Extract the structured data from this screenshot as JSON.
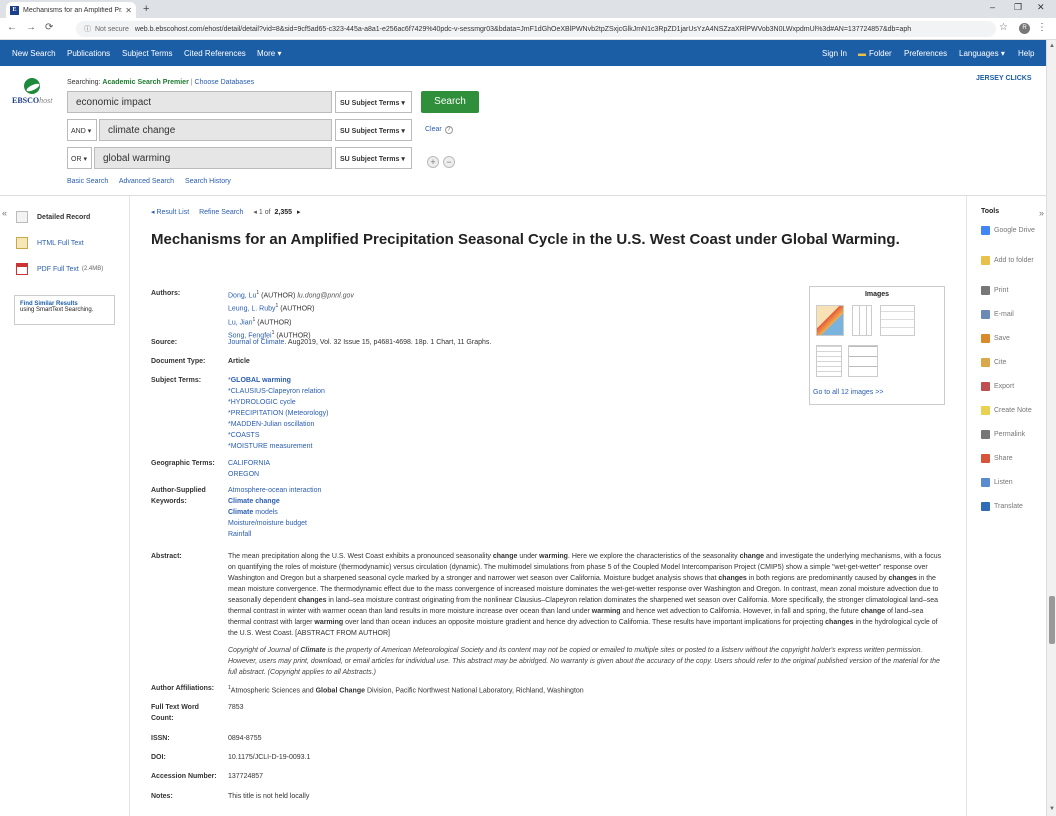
{
  "browser": {
    "tab_title": "Mechanisms for an Amplified Pr...",
    "url": "web.b.ebscohost.com/ehost/detail/detail?vid=8&sid=9cf5ad65-c323-445a-a8a1-e256ac6f7429%40pdc-v-sessmgr03&bdata=JmF1dGhOeXBlPWNvb2tpZSxjcGlkJmN1c3RpZD1jarUsYzA4NSZzaXRlPWVob3N0LWxpdmUl%3d#AN=137724857&db=aph",
    "not_secure": "Not secure",
    "avatar": "R"
  },
  "topnav": {
    "left": [
      "New Search",
      "Publications",
      "Subject Terms",
      "Cited References",
      "More ▾"
    ],
    "right": [
      "Sign In",
      "Folder",
      "Preferences",
      "Languages ▾",
      "Help"
    ]
  },
  "header": {
    "logo_word": "EBSCO",
    "logo_suffix": "host",
    "searching_label": "Searching:",
    "database": "Academic Search Premier",
    "choose": "Choose Databases",
    "jersey": "JERSEY CLICKS",
    "rows": [
      {
        "bool": "",
        "term": "economic impact",
        "field": "SU Subject Terms ▾"
      },
      {
        "bool": "AND ▾",
        "term": "climate change",
        "field": "SU Subject Terms ▾"
      },
      {
        "bool": "OR ▾",
        "term": "global warming",
        "field": "SU Subject Terms ▾"
      }
    ],
    "search_btn": "Search",
    "clear": "Clear",
    "plus": "+",
    "minus": "−",
    "links": [
      "Basic Search",
      "Advanced Search",
      "Search History"
    ]
  },
  "left": {
    "collapse": "«",
    "items": [
      {
        "label": "Detailed Record",
        "suffix": ""
      },
      {
        "label": "HTML Full Text",
        "suffix": ""
      },
      {
        "label": "PDF Full Text",
        "suffix": "(2.4MB)"
      }
    ],
    "similar_title": "Find Similar Results",
    "similar_sub": "using SmartText Searching."
  },
  "record": {
    "nav": {
      "result_list": "◂ Result List",
      "refine": "Refine Search",
      "counter_prefix": "◂ 1 of",
      "counter_total": "2,355",
      "counter_next": "▸"
    },
    "title": "Mechanisms for an Amplified Precipitation Seasonal Cycle in the U.S. West Coast under Global Warming.",
    "labels": {
      "authors": "Authors:",
      "source": "Source:",
      "doctype": "Document Type:",
      "subjects": "Subject Terms:",
      "geo": "Geographic Terms:",
      "keywords": "Author-Supplied Keywords:",
      "abstract": "Abstract:",
      "affil": "Author Affiliations:",
      "wordcount": "Full Text Word Count:",
      "issn": "ISSN:",
      "doi": "DOI:",
      "accession": "Accession Number:",
      "notes": "Notes:"
    },
    "authors": [
      {
        "name": "Dong, Lu",
        "sup": "1",
        "role": "(AUTHOR)",
        "email": "lu.dong@pnnl.gov"
      },
      {
        "name": "Leung, L. Ruby",
        "sup": "1",
        "role": "(AUTHOR)",
        "email": ""
      },
      {
        "name": "Lu, Jian",
        "sup": "1",
        "role": "(AUTHOR)",
        "email": ""
      },
      {
        "name": "Song, Fengfei",
        "sup": "1",
        "role": "(AUTHOR)",
        "email": ""
      }
    ],
    "source_journal": "Journal of Climate",
    "source_rest": ". Aug2019, Vol. 32 Issue 15, p4681-4698. 18p. 1 Chart, 11 Graphs.",
    "doctype": "Article",
    "subjects": [
      "*GLOBAL warming",
      "*CLAUSIUS-Clapeyron relation",
      "*HYDROLOGIC cycle",
      "*PRECIPITATION (Meteorology)",
      "*MADDEN-Julian oscillation",
      "*COASTS",
      "*MOISTURE measurement"
    ],
    "geo": [
      "CALIFORNIA",
      "OREGON"
    ],
    "keywords": [
      "Atmosphere-ocean interaction",
      "Climate change",
      "Climate models",
      "Moisture/moisture budget",
      "Rainfall"
    ],
    "abstract": "The mean precipitation along the U.S. West Coast exhibits a pronounced seasonality change under warming. Here we explore the characteristics of the seasonality change and investigate the underlying mechanisms, with a focus on quantifying the roles of moisture (thermodynamic) versus circulation (dynamic). The multimodel simulations from phase 5 of the Coupled Model Intercomparison Project (CMIP5) show a simple \"wet-get-wetter\" response over Washington and Oregon but a sharpened seasonal cycle marked by a stronger and narrower wet season over California. Moisture budget analysis shows that changes in both regions are predominantly caused by changes in the mean moisture convergence. The thermodynamic effect due to the mass convergence of increased moisture dominates the wet-get-wetter response over Washington and Oregon. In contrast, mean zonal moisture advection due to seasonally dependent changes in land–sea moisture contrast originating from the nonlinear Clausius–Clapeyron relation dominates the sharpened wet season over California. More specifically, the stronger climatological land–sea thermal contrast in winter with warmer ocean than land results in more moisture increase over ocean than land under warming and hence wet advection to California. However, in fall and spring, the future change of land–sea thermal contrast with larger warming over land than ocean induces an opposite moisture gradient and hence dry advection to California. These results have important implications for projecting changes in the hydrological cycle of the U.S. West Coast. [ABSTRACT FROM AUTHOR]",
    "copyright": "Copyright of Journal of Climate is the property of American Meteorological Society and its content may not be copied or emailed to multiple sites or posted to a listserv without the copyright holder's express written permission. However, users may print, download, or email articles for individual use. This abstract may be abridged. No warranty is given about the accuracy of the copy. Users should refer to the original published version of the material for the full abstract. (Copyright applies to all Abstracts.)",
    "affil": "Atmospheric Sciences and Global Change Division, Pacific Northwest National Laboratory, Richland, Washington",
    "affil_sup": "1",
    "wordcount": "7853",
    "issn": "0894-8755",
    "doi": "10.1175/JCLI-D-19-0093.1",
    "accession": "137724857",
    "notes": "This title is not held locally"
  },
  "images_box": {
    "title": "Images",
    "link": "Go to all 12 images >>"
  },
  "tools": {
    "title": "Tools",
    "collapse": "»",
    "items": [
      {
        "label": "Google Drive",
        "color": "#4285f4"
      },
      {
        "label": "Add to folder",
        "color": "#e8c04a"
      },
      {
        "label": "Print",
        "color": "#777777"
      },
      {
        "label": "E-mail",
        "color": "#6a8ab5"
      },
      {
        "label": "Save",
        "color": "#d98b2b"
      },
      {
        "label": "Cite",
        "color": "#d9a84a"
      },
      {
        "label": "Export",
        "color": "#c05050"
      },
      {
        "label": "Create Note",
        "color": "#e8d050"
      },
      {
        "label": "Permalink",
        "color": "#777777"
      },
      {
        "label": "Share",
        "color": "#d9533b"
      },
      {
        "label": "Listen",
        "color": "#5a8ad0"
      },
      {
        "label": "Translate",
        "color": "#2e6bb8"
      }
    ]
  }
}
